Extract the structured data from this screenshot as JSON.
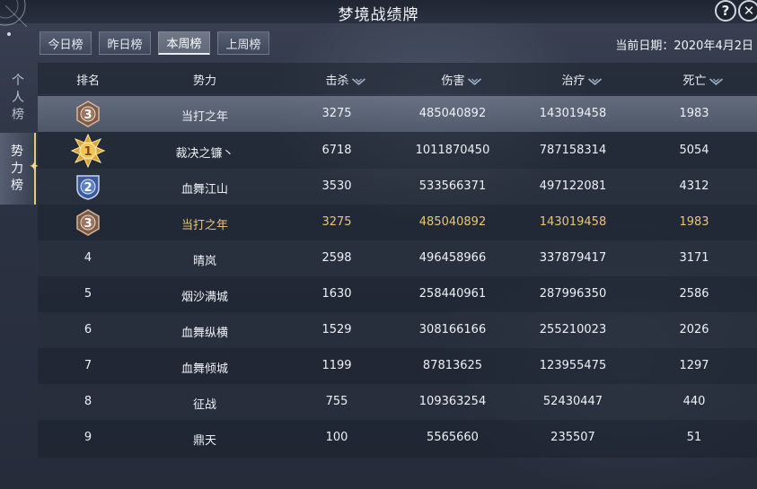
{
  "window": {
    "title": "梦境战绩牌"
  },
  "side_tabs": [
    {
      "label": [
        "个",
        "人",
        "榜"
      ],
      "active": false
    },
    {
      "label": [
        "势",
        "力",
        "榜"
      ],
      "active": true
    }
  ],
  "tabs": [
    {
      "label": "今日榜",
      "active": false
    },
    {
      "label": "昨日榜",
      "active": false
    },
    {
      "label": "本周榜",
      "active": true
    },
    {
      "label": "上周榜",
      "active": false
    }
  ],
  "current_date": "当前日期：2020年4月2日",
  "table": {
    "headers": [
      "排名",
      "势力",
      "击杀",
      "伤害",
      "治疗",
      "死亡"
    ],
    "self_row": {
      "rank": "3",
      "faction": "当打之年",
      "kills": "3275",
      "damage": "485040892",
      "healing": "143019458",
      "deaths": "1983"
    },
    "rows": [
      {
        "rank": "1",
        "faction": "裁决之镰丶",
        "kills": "6718",
        "damage": "1011870450",
        "healing": "787158314",
        "deaths": "5054"
      },
      {
        "rank": "2",
        "faction": "血舞江山",
        "kills": "3530",
        "damage": "533566371",
        "healing": "497122081",
        "deaths": "4312"
      },
      {
        "rank": "3",
        "faction": "当打之年",
        "kills": "3275",
        "damage": "485040892",
        "healing": "143019458",
        "deaths": "1983"
      },
      {
        "rank": "4",
        "faction": "晴岚",
        "kills": "2598",
        "damage": "496458966",
        "healing": "337879417",
        "deaths": "3171"
      },
      {
        "rank": "5",
        "faction": "烟沙满城",
        "kills": "1630",
        "damage": "258440961",
        "healing": "287996350",
        "deaths": "2586"
      },
      {
        "rank": "6",
        "faction": "血舞纵横",
        "kills": "1529",
        "damage": "308166166",
        "healing": "255210023",
        "deaths": "2026"
      },
      {
        "rank": "7",
        "faction": "血舞倾城",
        "kills": "1199",
        "damage": "87813625",
        "healing": "123955475",
        "deaths": "1297"
      },
      {
        "rank": "8",
        "faction": "征战",
        "kills": "755",
        "damage": "109363254",
        "healing": "52430447",
        "deaths": "440"
      },
      {
        "rank": "9",
        "faction": "鼎天",
        "kills": "100",
        "damage": "5565660",
        "healing": "235507",
        "deaths": "51"
      }
    ]
  },
  "colors": {
    "self_highlight_text": "#e9c47e",
    "gold_badge": "#e8b84a",
    "silver_badge": "#5d7fc4",
    "bronze_badge": "#8a6a55"
  },
  "icons": {
    "help": "?",
    "close": "✕",
    "sort": "chevron-down-icon"
  }
}
